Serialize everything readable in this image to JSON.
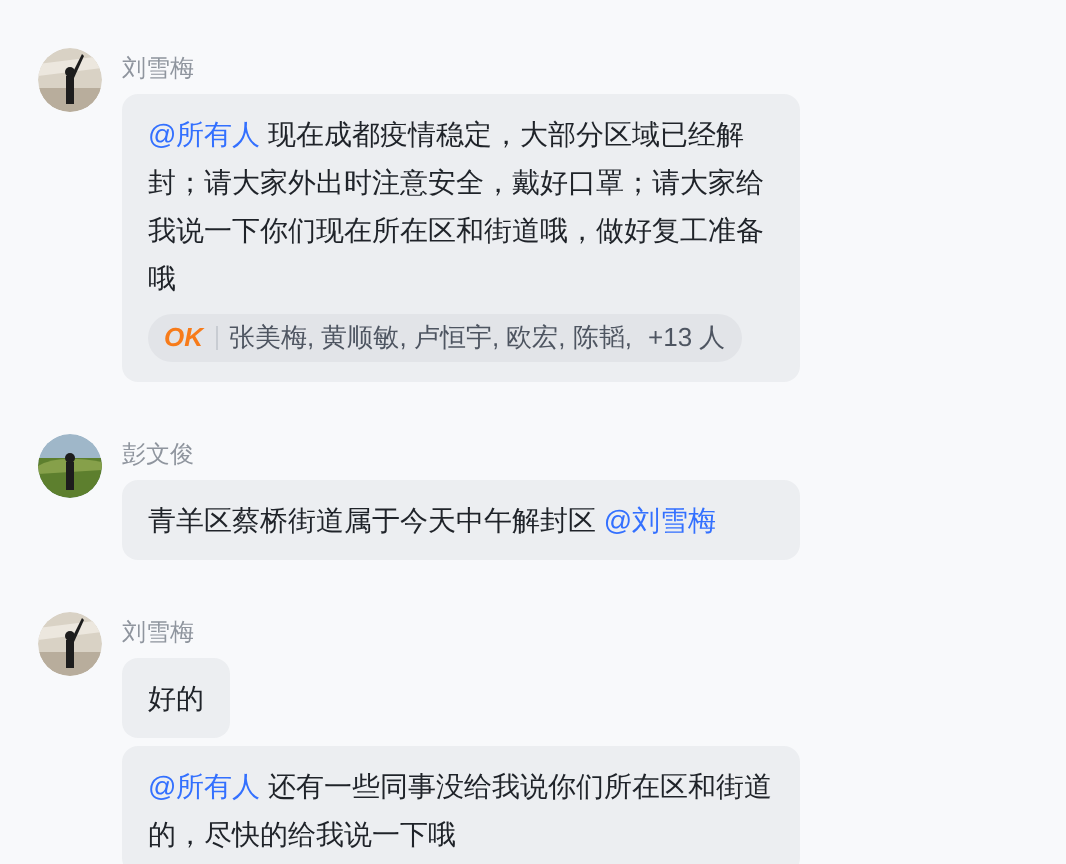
{
  "messages": [
    {
      "sender": "刘雪梅",
      "bubbles": [
        {
          "parts": [
            {
              "kind": "mention",
              "text": "@所有人"
            },
            {
              "kind": "text",
              "text": " 现在成都疫情稳定，大部分区域已经解封；请大家外出时注意安全，戴好口罩；请大家给我说一下你们现在所在区和街道哦，做好复工准备哦"
            }
          ],
          "reaction": {
            "emoji": "OK",
            "names": "张美梅, 黄顺敏, 卢恒宇, 欧宏, 陈韬,",
            "count": "+13 人"
          }
        }
      ]
    },
    {
      "sender": "彭文俊",
      "bubbles": [
        {
          "parts": [
            {
              "kind": "text",
              "text": "青羊区蔡桥街道属于今天中午解封区 "
            },
            {
              "kind": "mention",
              "text": "@刘雪梅"
            }
          ]
        }
      ]
    },
    {
      "sender": "刘雪梅",
      "bubbles": [
        {
          "parts": [
            {
              "kind": "text",
              "text": "好的"
            }
          ]
        },
        {
          "parts": [
            {
              "kind": "mention",
              "text": "@所有人"
            },
            {
              "kind": "text",
              "text": " 还有一些同事没给我说你们所在区和街道的，尽快的给我说一下哦"
            }
          ]
        }
      ]
    }
  ]
}
